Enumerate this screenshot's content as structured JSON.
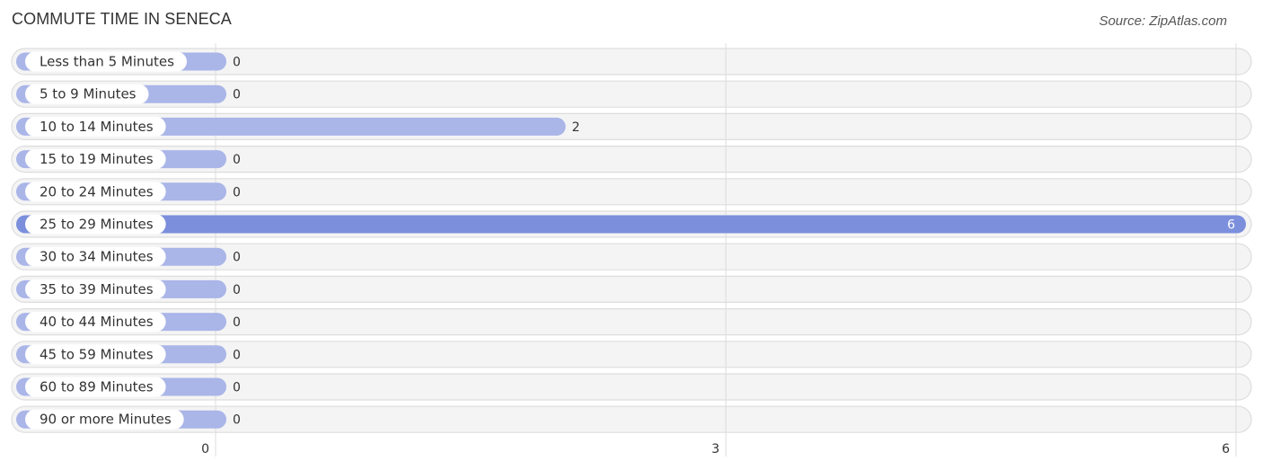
{
  "chart_data": {
    "type": "bar",
    "orientation": "horizontal",
    "title": "COMMUTE TIME IN SENECA",
    "source": "Source: ZipAtlas.com",
    "categories": [
      "Less than 5 Minutes",
      "5 to 9 Minutes",
      "10 to 14 Minutes",
      "15 to 19 Minutes",
      "20 to 24 Minutes",
      "25 to 29 Minutes",
      "30 to 34 Minutes",
      "35 to 39 Minutes",
      "40 to 44 Minutes",
      "45 to 59 Minutes",
      "60 to 89 Minutes",
      "90 or more Minutes"
    ],
    "values": [
      0,
      0,
      2,
      0,
      0,
      6,
      0,
      0,
      0,
      0,
      0,
      0
    ],
    "value_labels": [
      "0",
      "0",
      "2",
      "0",
      "0",
      "6",
      "0",
      "0",
      "0",
      "0",
      "0",
      "0"
    ],
    "xlim": [
      0,
      6
    ],
    "xticks": [
      0,
      3,
      6
    ],
    "xtick_labels": [
      "0",
      "3",
      "6"
    ],
    "xlabel": "",
    "ylabel": "",
    "grid": true,
    "legend": "none",
    "colors": {
      "bar": "#aab5e8",
      "bar_max": "#7b8fdc",
      "row_bg": "#f4f4f4",
      "row_border": "#dddddd",
      "grid": "#dddddd",
      "label_pill": "#ffffff"
    }
  }
}
